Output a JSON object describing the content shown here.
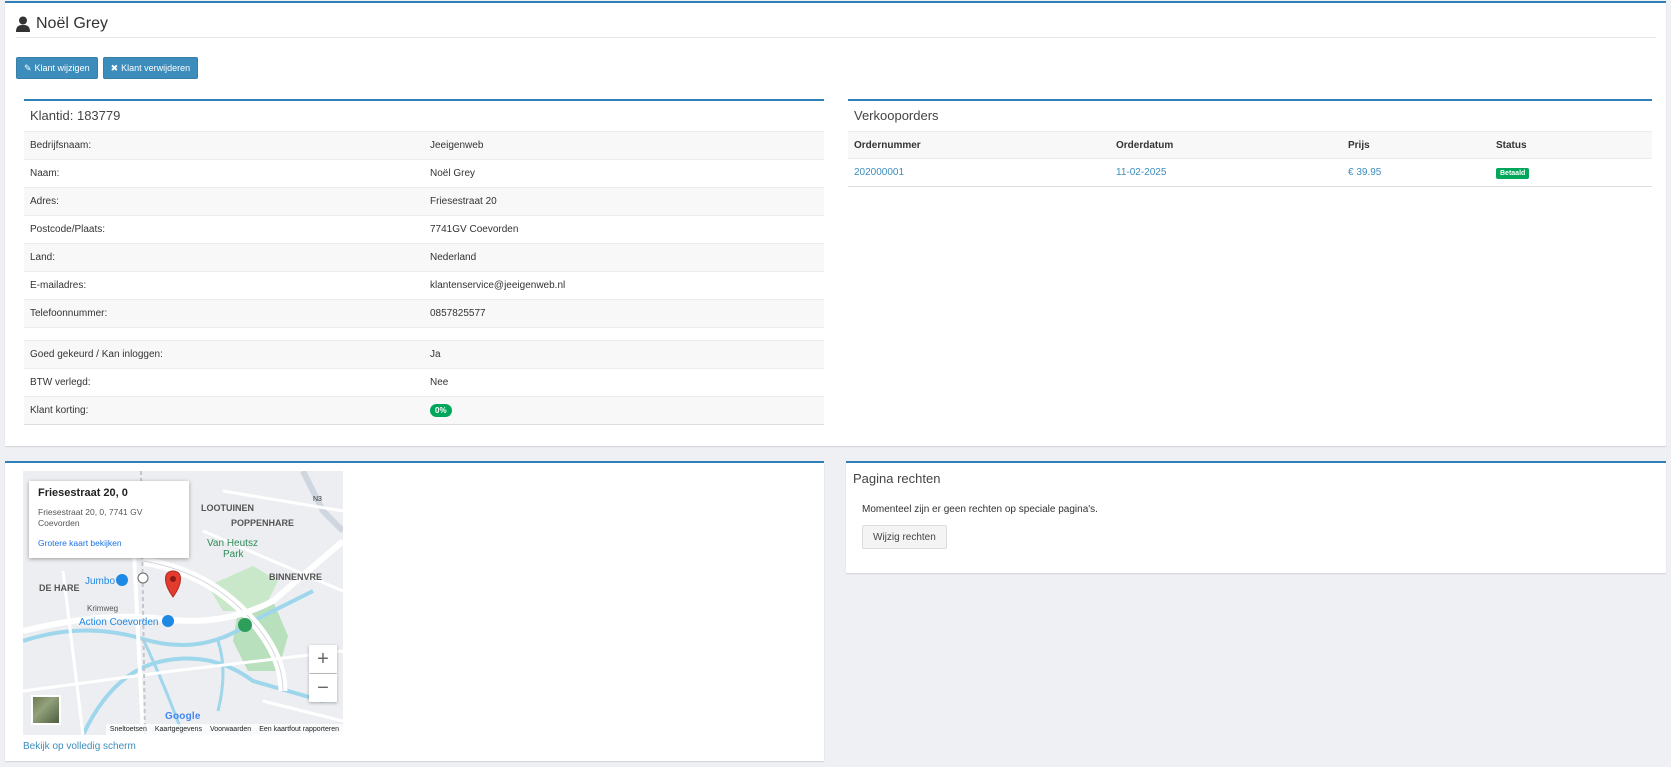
{
  "header": {
    "title": "Noël Grey",
    "icon": "user-icon"
  },
  "actions": {
    "edit_label": "Klant wijzigen",
    "delete_label": "Klant verwijderen"
  },
  "customer": {
    "title": "Klantid: 183779",
    "rows": [
      {
        "label": "Bedrijfsnaam:",
        "value": "Jeeigenweb"
      },
      {
        "label": "Naam:",
        "value": "Noël Grey"
      },
      {
        "label": "Adres:",
        "value": "Friesestraat 20"
      },
      {
        "label": "Postcode/Plaats:",
        "value": "7741GV Coevorden"
      },
      {
        "label": "Land:",
        "value": "Nederland"
      },
      {
        "label": "E-mailadres:",
        "value": "klantenservice@jeeigenweb.nl"
      },
      {
        "label": "Telefoonnummer:",
        "value": "0857825577"
      }
    ],
    "rows2": [
      {
        "label": "Goed gekeurd / Kan inloggen:",
        "value": "Ja"
      },
      {
        "label": "BTW verlegd:",
        "value": "Nee"
      },
      {
        "label": "Klant korting:",
        "value": "0%"
      }
    ]
  },
  "orders": {
    "title": "Verkooporders",
    "columns": [
      "Ordernummer",
      "Orderdatum",
      "Prijs",
      "Status"
    ],
    "rows": [
      {
        "number": "202000001",
        "date": "11-02-2025",
        "price": "€ 39.95",
        "status": "Betaald"
      }
    ]
  },
  "map": {
    "info_title": "Friesestraat 20, 0",
    "info_address": "Friesestraat 20, 0, 7741 GV Coevorden",
    "info_link": "Grotere kaart bekijken",
    "labels": {
      "lootuinen": "LOOTUINEN",
      "poppenhare": "POPPENHARE",
      "vanheutsz": "Van Heutsz",
      "park": "Park",
      "binnenvre": "BINNENVRE",
      "dehare": "DE HARE",
      "jumbo": "Jumbo",
      "krimweg": "Krimweg",
      "action": "Action Coevorden",
      "road_n": "N3"
    },
    "zoom_in": "+",
    "zoom_out": "−",
    "google": "Google",
    "footer": [
      "Sneltoetsen",
      "Kaartgegevens",
      "Voorwaarden",
      "Een kaartfout rapporteren"
    ],
    "fullscreen": "Bekijk op volledig scherm"
  },
  "rights": {
    "title": "Pagina rechten",
    "text": "Momenteel zijn er geen rechten op speciale pagina's.",
    "button": "Wijzig rechten"
  }
}
